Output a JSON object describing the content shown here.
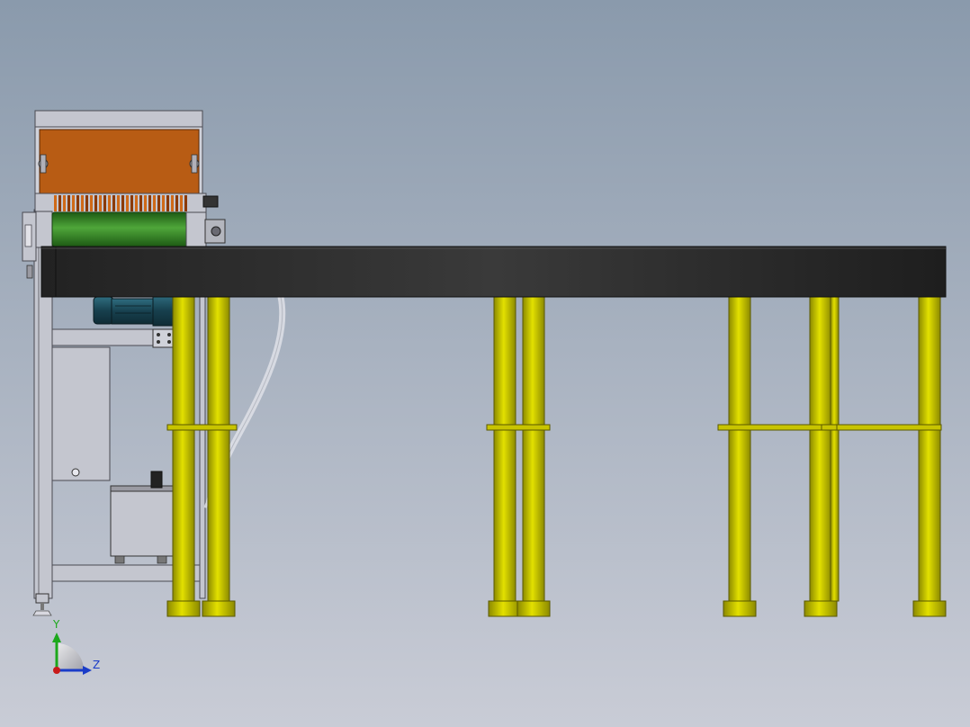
{
  "viewport": {
    "background_top": "#8a9aac",
    "background_bottom": "#c9ccd6"
  },
  "colors": {
    "frame": "#c4c6cf",
    "frame_stroke": "#4a4a52",
    "hood": "#b85c14",
    "roller": "#2e7d22",
    "brush": "#c25a10",
    "belt": "#2b2b2b",
    "leg": "#c8c400",
    "leg_dark": "#8a8600",
    "motor": "#1e4a5a",
    "pipe": "#e2e4ea"
  },
  "triad": {
    "y_label": "Y",
    "z_label": "Z",
    "y_color": "#1ca81c",
    "z_color": "#1a3cc8",
    "x_color": "#c81a1a"
  }
}
